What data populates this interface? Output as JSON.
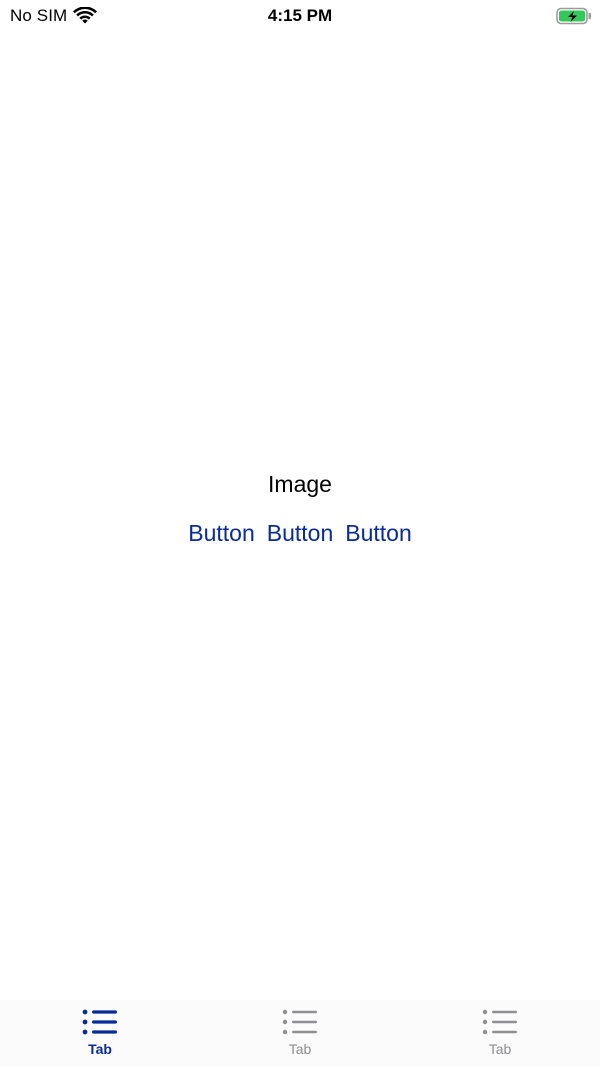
{
  "status_bar": {
    "carrier": "No SIM",
    "time": "4:15 PM",
    "wifi_icon": "wifi-icon",
    "battery_icon": "battery-charging-icon",
    "battery_color": "#34c759"
  },
  "main": {
    "image_placeholder": "Image",
    "buttons": [
      {
        "label": "Button"
      },
      {
        "label": "Button"
      },
      {
        "label": "Button"
      }
    ],
    "accent_color": "#0a2a9a"
  },
  "tab_bar": {
    "tabs": [
      {
        "label": "Tab",
        "icon": "list-icon",
        "active": true
      },
      {
        "label": "Tab",
        "icon": "list-icon",
        "active": false
      },
      {
        "label": "Tab",
        "icon": "list-icon",
        "active": false
      }
    ],
    "active_color": "#0a2a9a",
    "inactive_color": "#8e8e93"
  }
}
